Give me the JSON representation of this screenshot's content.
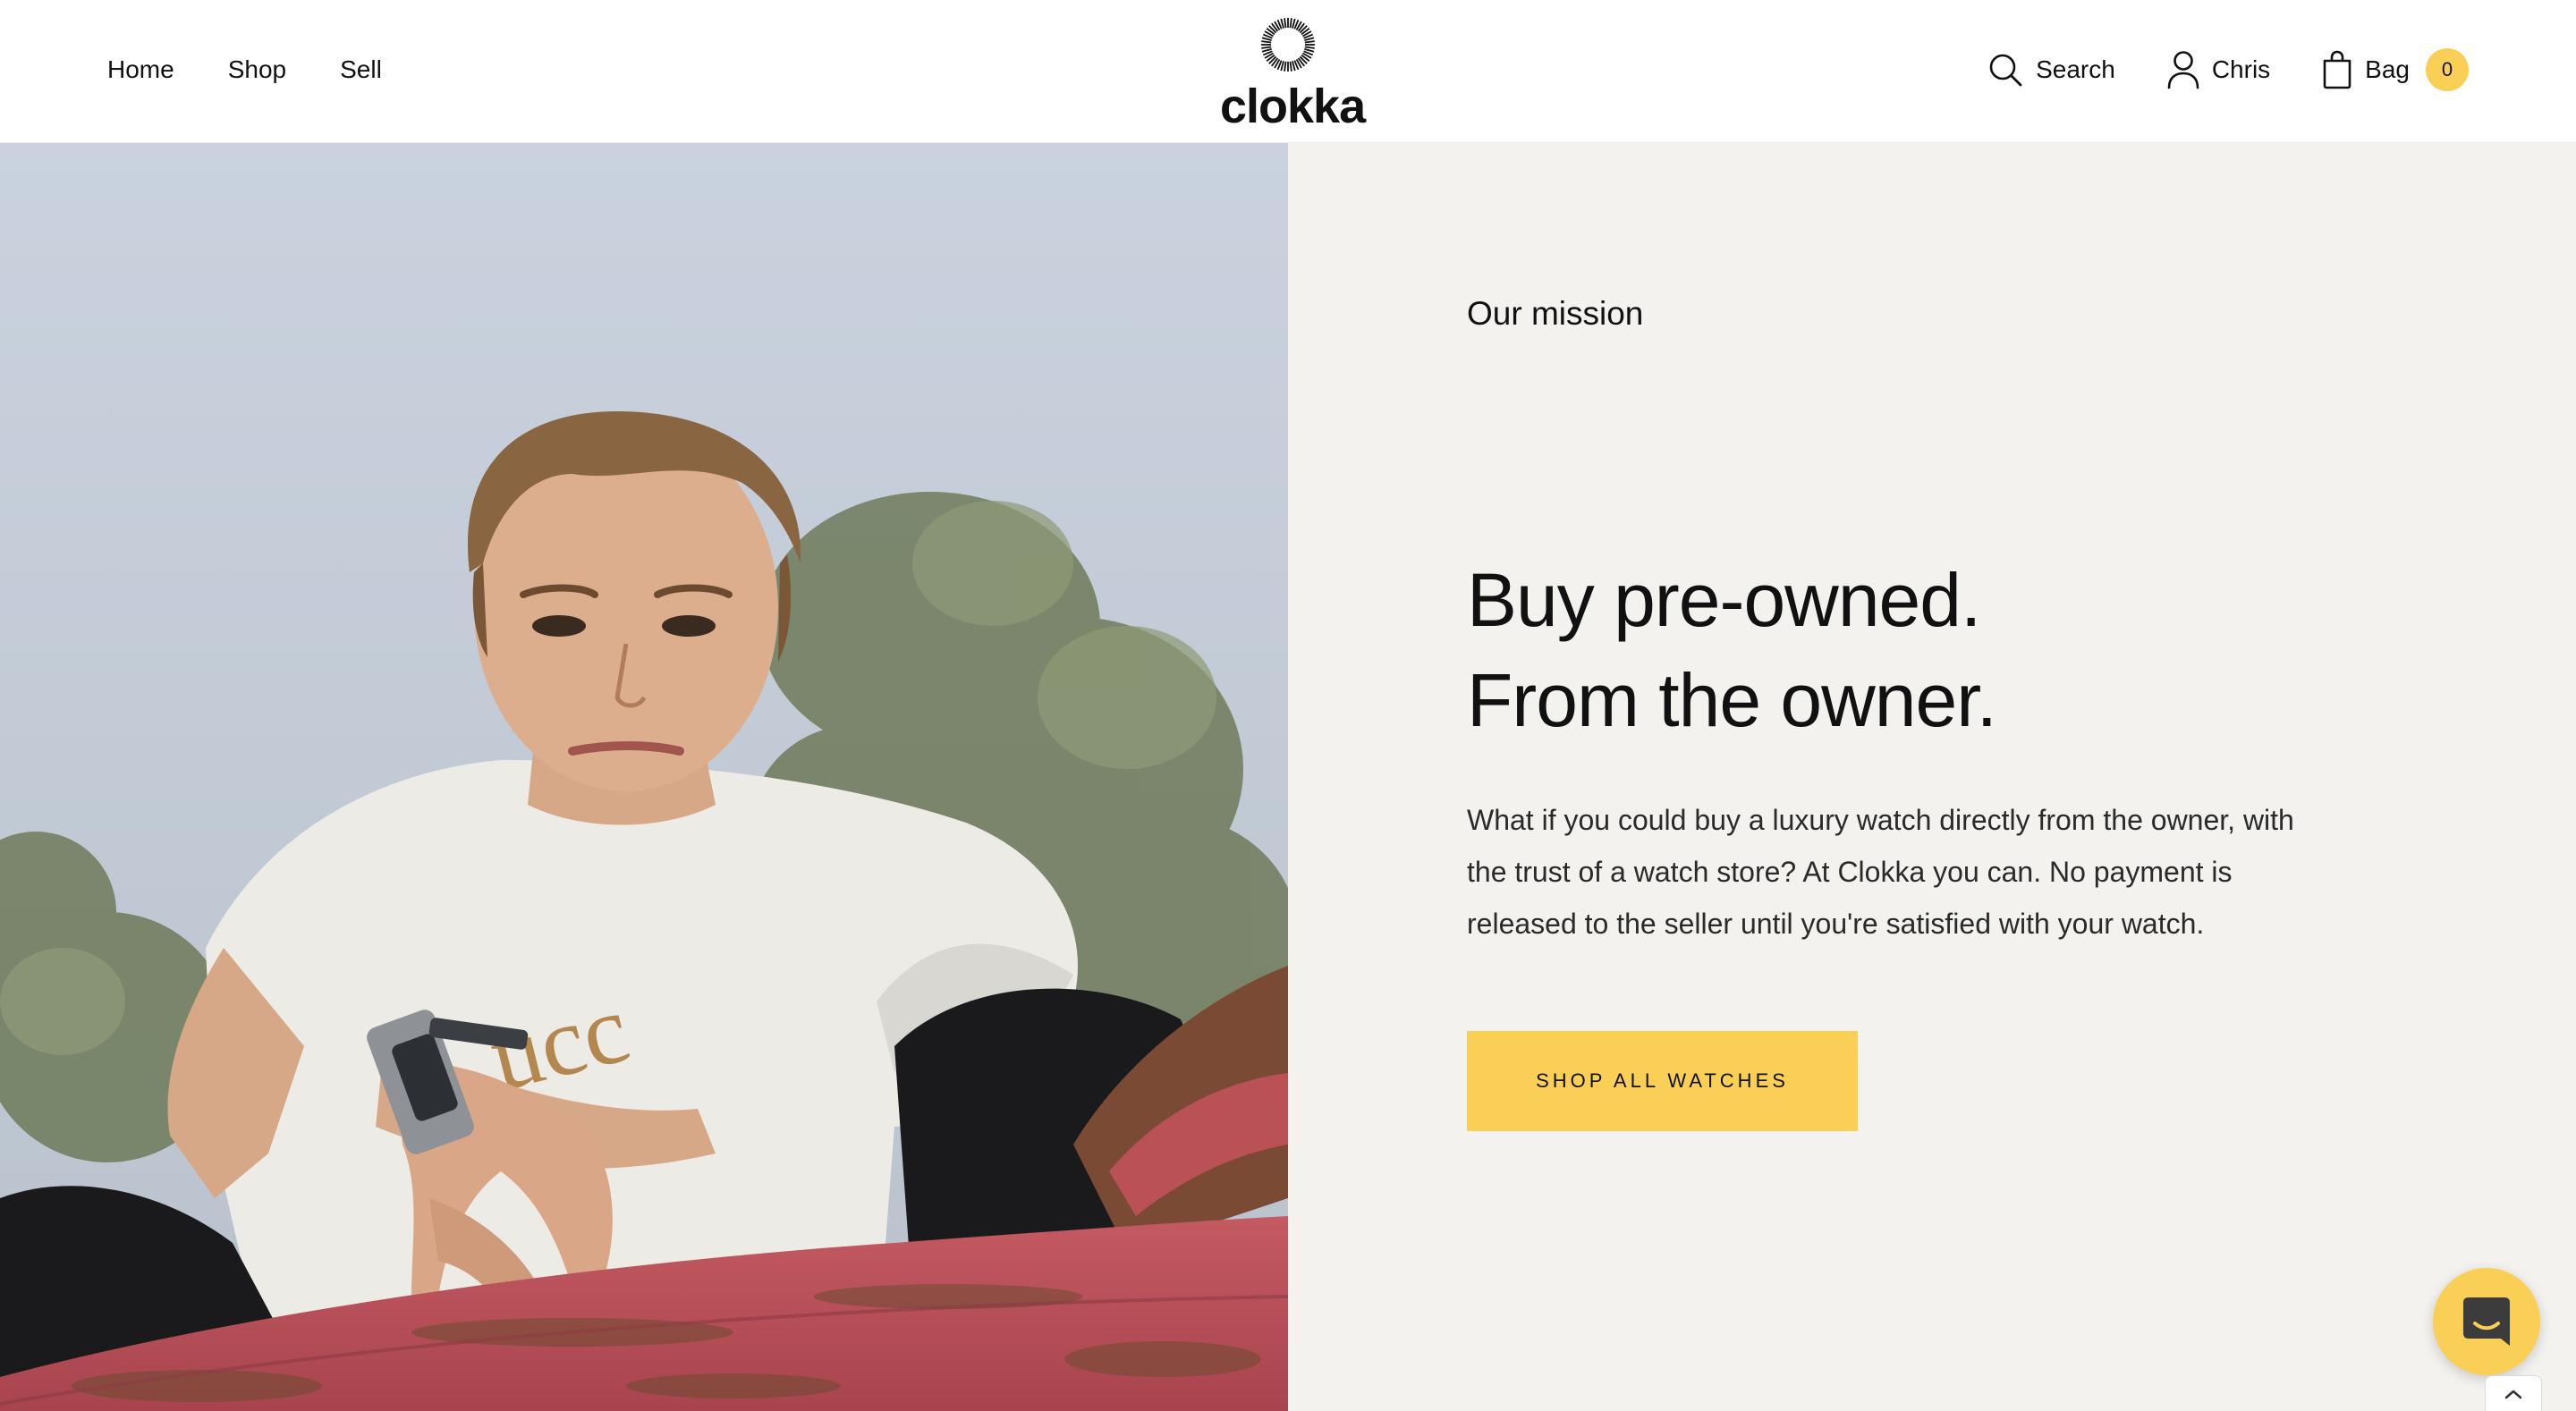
{
  "header": {
    "nav_left": [
      {
        "label": "Home"
      },
      {
        "label": "Shop"
      },
      {
        "label": "Sell"
      }
    ],
    "logo_text": "clokka",
    "search_label": "Search",
    "account_label": "Chris",
    "bag_label": "Bag",
    "bag_count": "0"
  },
  "mission": {
    "eyebrow": "Our mission",
    "headline_line1": "Buy pre-owned.",
    "headline_line2": "From the owner.",
    "body": "What if you could buy a luxury watch directly from the owner, with the trust of a watch store? At Clokka you can. No payment is released to the seller until you're satisfied with your watch.",
    "cta_label": "SHOP ALL WATCHES"
  },
  "hero_image": {
    "subject": "young man in white t-shirt wearing a steel wristwatch, sitting above a weathered red painted beam"
  },
  "colors": {
    "accent": "#f9cf55",
    "panel_background": "#f3f2ee",
    "text": "#111111"
  },
  "icons": {
    "search": "search-icon",
    "account": "user-icon",
    "bag": "shopping-bag-icon",
    "chat": "chat-icon",
    "scroll_top": "chevron-up-icon"
  }
}
